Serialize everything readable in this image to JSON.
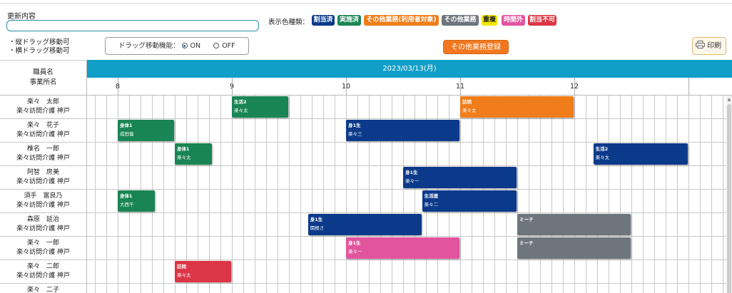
{
  "update": {
    "label": "更新内容",
    "value": ""
  },
  "legend": {
    "label": "表示色種類：",
    "items": [
      {
        "label": "割当済",
        "color": "#0c3a8a"
      },
      {
        "label": "実施済",
        "color": "#1a8554"
      },
      {
        "label": "その他業務(利用者対象)",
        "color": "#f07d1a"
      },
      {
        "label": "その他業務",
        "color": "#6e757c"
      },
      {
        "label": "重複",
        "color": "#f3e600"
      },
      {
        "label": "時間外",
        "color": "#e2549e"
      },
      {
        "label": "割当不可",
        "color": "#dc3545"
      }
    ]
  },
  "drag_notes": [
    "・縦ドラッグ移動可",
    "・横ドラッグ移動可"
  ],
  "drag_feature": {
    "label": "ドラッグ移動機能：",
    "on": "ON",
    "off": "OFF",
    "selected": "ON"
  },
  "buttons": {
    "other_work": "その他業務登録",
    "print": "印刷",
    "print_icon": "printer-icon"
  },
  "schedule": {
    "header_staff": "職員名",
    "header_office": "事業所名",
    "date": "2023/03/13(月)",
    "hours": [
      "8",
      "9",
      "10",
      "11",
      "12"
    ],
    "rows": [
      {
        "staff": "楽々　太郎",
        "office": "楽々訪問介護 神戸"
      },
      {
        "staff": "楽々　花子",
        "office": "楽々訪問介護 神戸"
      },
      {
        "staff": "椎名　一郎",
        "office": "楽々訪問介護 神戸"
      },
      {
        "staff": "阿智　房美",
        "office": "楽々訪問介護 神戸"
      },
      {
        "staff": "須手　富良乃",
        "office": "楽々訪問介護 神戸"
      },
      {
        "staff": "森原　延治",
        "office": "楽々訪問介護 神戸"
      },
      {
        "staff": "楽々　一郎",
        "office": "楽々訪問介護 神戸"
      },
      {
        "staff": "楽々　二郎",
        "office": "楽々訪問介護 神戸"
      },
      {
        "staff": "楽々　二子",
        "office": ""
      }
    ],
    "blocks": [
      {
        "row": 0,
        "start": "9:00",
        "end": "9:30",
        "title": "生活2",
        "client": "楽々太",
        "color": "#1a8554"
      },
      {
        "row": 0,
        "start": "11:00",
        "end": "12:00",
        "title": "訪問",
        "client": "楽々太",
        "color": "#f07d1a"
      },
      {
        "row": 1,
        "start": "8:00",
        "end": "8:30",
        "title": "身体1",
        "client": "成田倫",
        "color": "#1a8554"
      },
      {
        "row": 1,
        "start": "10:00",
        "end": "11:00",
        "title": "身1生",
        "client": "楽々三",
        "color": "#0c3a8a"
      },
      {
        "row": 2,
        "start": "8:30",
        "end": "8:50",
        "title": "身体1",
        "client": "楽々太",
        "color": "#1a8554"
      },
      {
        "row": 2,
        "start": "12:10",
        "end": "13:00",
        "title": "生活2",
        "client": "楽々太",
        "color": "#0c3a8a"
      },
      {
        "row": 3,
        "start": "10:30",
        "end": "11:30",
        "title": "身1生",
        "client": "楽々一",
        "color": "#0c3a8a"
      },
      {
        "row": 4,
        "start": "8:00",
        "end": "8:20",
        "title": "身体1",
        "client": "大西千",
        "color": "#1a8554"
      },
      {
        "row": 4,
        "start": "10:40",
        "end": "11:30",
        "title": "生活援",
        "client": "楽々二",
        "color": "#0c3a8a"
      },
      {
        "row": 5,
        "start": "9:40",
        "end": "10:40",
        "title": "身1生",
        "client": "関根さ",
        "color": "#0c3a8a"
      },
      {
        "row": 5,
        "start": "11:30",
        "end": "12:30",
        "title": "ミーテ",
        "client": "",
        "color": "#6e757c"
      },
      {
        "row": 6,
        "start": "10:00",
        "end": "11:00",
        "title": "身1生",
        "client": "楽々一",
        "color": "#e2549e"
      },
      {
        "row": 6,
        "start": "11:30",
        "end": "12:30",
        "title": "ミーテ",
        "client": "",
        "color": "#6e757c"
      },
      {
        "row": 7,
        "start": "8:30",
        "end": "9:00",
        "title": "訪問",
        "client": "楽々太",
        "color": "#dc3545"
      }
    ]
  }
}
